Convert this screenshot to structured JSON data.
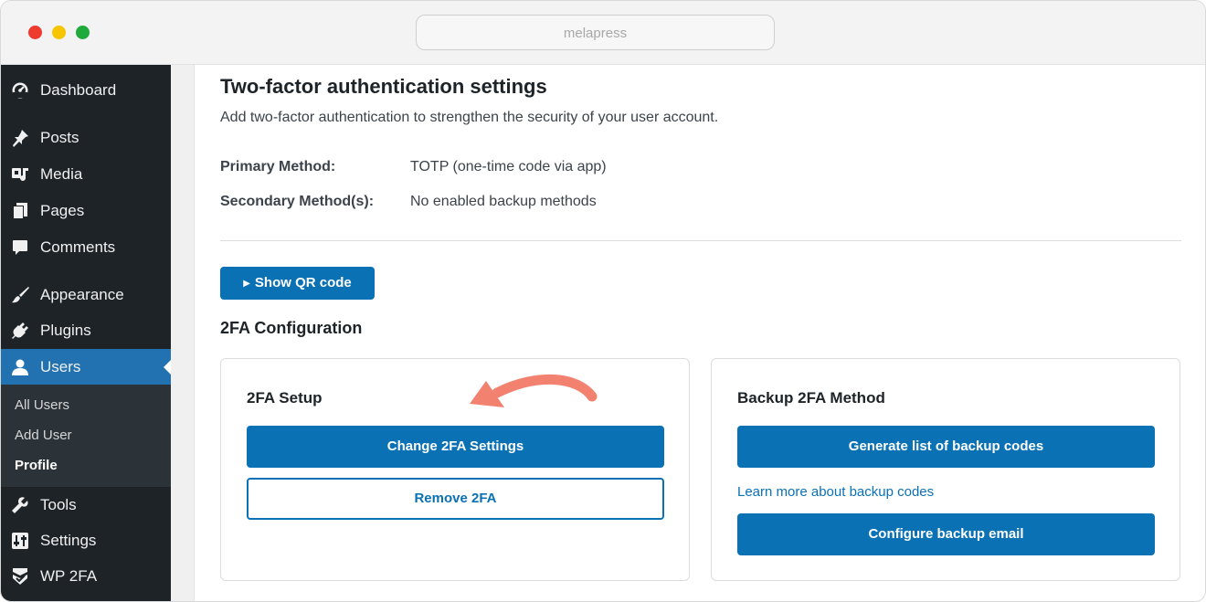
{
  "browser": {
    "address_text": "melapress"
  },
  "sidebar": {
    "items": [
      {
        "label": "Dashboard",
        "icon": "dashboard-icon"
      },
      {
        "label": "Posts",
        "icon": "pin-icon"
      },
      {
        "label": "Media",
        "icon": "media-icon"
      },
      {
        "label": "Pages",
        "icon": "pages-icon"
      },
      {
        "label": "Comments",
        "icon": "comment-icon"
      },
      {
        "label": "Appearance",
        "icon": "brush-icon"
      },
      {
        "label": "Plugins",
        "icon": "plug-icon"
      },
      {
        "label": "Users",
        "icon": "user-icon",
        "active": true
      },
      {
        "label": "Tools",
        "icon": "wrench-icon"
      },
      {
        "label": "Settings",
        "icon": "settings-icon"
      },
      {
        "label": "WP 2FA",
        "icon": "wp2fa-icon"
      }
    ],
    "users_submenu": [
      "All Users",
      "Add User",
      "Profile"
    ],
    "current_submenu": "Profile"
  },
  "main": {
    "title": "Two-factor authentication settings",
    "description": "Add two-factor authentication to strengthen the security of your user account.",
    "primary_method_label": "Primary Method:",
    "primary_method_value": "TOTP (one-time code via app)",
    "secondary_method_label": "Secondary Method(s):",
    "secondary_method_value": "No enabled backup methods",
    "qr_button_label": "Show QR code",
    "config_heading": "2FA Configuration",
    "setup_card": {
      "title": "2FA Setup",
      "change_button": "Change 2FA Settings",
      "remove_button": "Remove 2FA"
    },
    "backup_card": {
      "title": "Backup 2FA Method",
      "generate_button": "Generate list of backup codes",
      "learn_link": "Learn more about backup codes",
      "email_button": "Configure backup email"
    }
  },
  "colors": {
    "accent": "#0a71b5",
    "sidebar_bg": "#1d2327",
    "active_item": "#2271b1",
    "annotation_arrow": "#f2826f"
  }
}
